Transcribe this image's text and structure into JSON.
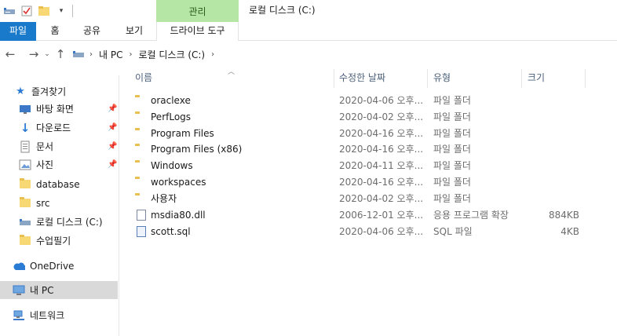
{
  "window": {
    "title": "로컬 디스크 (C:)",
    "manage_tab": "관리"
  },
  "ribbon": {
    "tabs": [
      "파일",
      "홈",
      "공유",
      "보기",
      "드라이브 도구"
    ]
  },
  "address": {
    "path": [
      "내 PC",
      "로컬 디스크 (C:)"
    ]
  },
  "sidebar": {
    "quick_access": "즐겨찾기",
    "items": [
      {
        "label": "바탕 화면",
        "icon": "desktop-icon",
        "pinned": true
      },
      {
        "label": "다운로드",
        "icon": "download-icon",
        "pinned": true
      },
      {
        "label": "문서",
        "icon": "documents-icon",
        "pinned": true
      },
      {
        "label": "사진",
        "icon": "pictures-icon",
        "pinned": true
      },
      {
        "label": "database",
        "icon": "folder-icon",
        "pinned": false
      },
      {
        "label": "src",
        "icon": "folder-icon",
        "pinned": false
      },
      {
        "label": "로컬 디스크 (C:)",
        "icon": "drive-icon",
        "pinned": false
      },
      {
        "label": "수업필기",
        "icon": "folder-icon",
        "pinned": false
      }
    ],
    "onedrive": "OneDrive",
    "this_pc": "내 PC",
    "network": "네트워크"
  },
  "columns": {
    "name": "이름",
    "date": "수정한 날짜",
    "type": "유형",
    "size": "크기"
  },
  "files": [
    {
      "name": "oraclexe",
      "date": "2020-04-06 오후...",
      "type": "파일 폴더",
      "size": "",
      "kind": "folder"
    },
    {
      "name": "PerfLogs",
      "date": "2020-04-02 오후...",
      "type": "파일 폴더",
      "size": "",
      "kind": "folder"
    },
    {
      "name": "Program Files",
      "date": "2020-04-16 오후...",
      "type": "파일 폴더",
      "size": "",
      "kind": "folder"
    },
    {
      "name": "Program Files (x86)",
      "date": "2020-04-16 오후...",
      "type": "파일 폴더",
      "size": "",
      "kind": "folder"
    },
    {
      "name": "Windows",
      "date": "2020-04-11 오후...",
      "type": "파일 폴더",
      "size": "",
      "kind": "folder"
    },
    {
      "name": "workspaces",
      "date": "2020-04-16 오후...",
      "type": "파일 폴더",
      "size": "",
      "kind": "folder"
    },
    {
      "name": "사용자",
      "date": "2020-04-02 오후...",
      "type": "파일 폴더",
      "size": "",
      "kind": "folder"
    },
    {
      "name": "msdia80.dll",
      "date": "2006-12-01 오후...",
      "type": "응용 프로그램 확장",
      "size": "884KB",
      "kind": "dll"
    },
    {
      "name": "scott.sql",
      "date": "2020-04-06 오후...",
      "type": "SQL 파일",
      "size": "4KB",
      "kind": "sql"
    }
  ],
  "colors": {
    "file_tab": "#1979ca",
    "manage_tab": "#b5e6a5",
    "selected": "#d9d9d9",
    "folder": "#f8d775"
  }
}
